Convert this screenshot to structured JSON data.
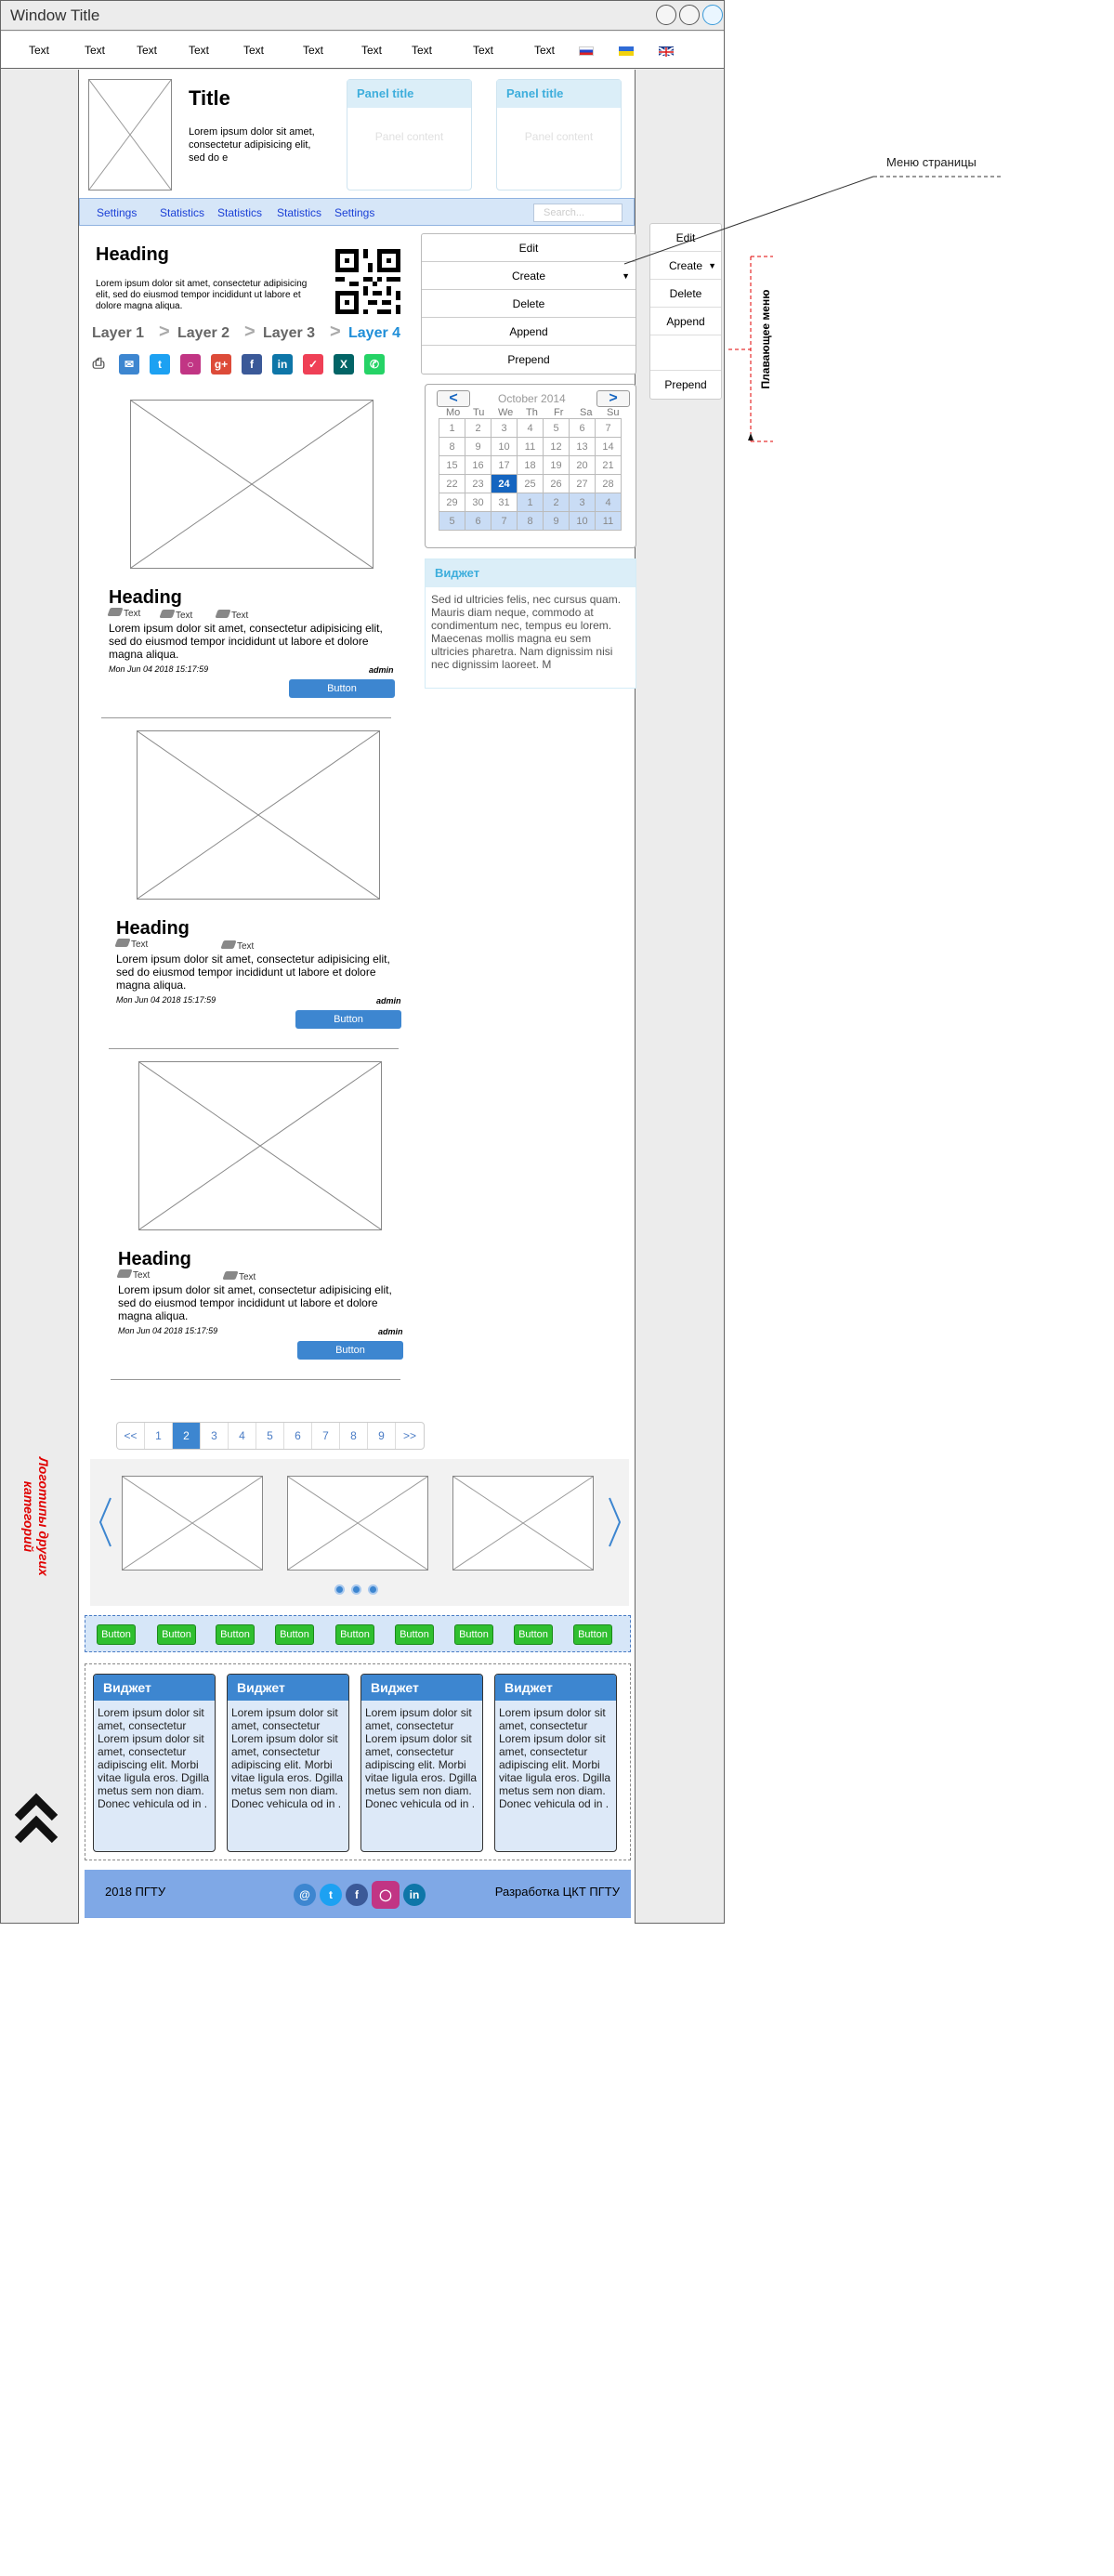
{
  "window": {
    "title": "Window Title"
  },
  "menubar": {
    "items": [
      "Text",
      "Text",
      "Text",
      "Text",
      "Text",
      "Text",
      "Text",
      "Text",
      "Text",
      "Text"
    ]
  },
  "header": {
    "title": "Title",
    "description": "Lorem ipsum dolor sit amet, consectetur adipisicing elit, sed do e"
  },
  "panels": [
    {
      "title": "Panel title",
      "content": "Panel content"
    },
    {
      "title": "Panel title",
      "content": "Panel content"
    }
  ],
  "nav": {
    "items": [
      "Settings",
      "Statistics",
      "Statistics",
      "Statistics",
      "Settings"
    ],
    "search_placeholder": "Search..."
  },
  "intro": {
    "heading": "Heading",
    "text": "Lorem ipsum dolor sit amet, consectetur adipisicing elit, sed do eiusmod tempor incididunt ut labore et dolore magna aliqua."
  },
  "breadcrumb": {
    "items": [
      "Layer 1",
      "Layer 2",
      "Layer 3",
      "Layer 4"
    ],
    "sep": ">"
  },
  "page_menu": {
    "items": [
      "Edit",
      "Create",
      "Delete",
      "Append",
      "Prepend"
    ]
  },
  "floating_menu": {
    "items": [
      "Edit",
      "Create",
      "Delete",
      "Append",
      "",
      "Prepend"
    ],
    "label": "Плавающее меню"
  },
  "annotation": {
    "page_menu_label": "Меню страницы",
    "side_label": "Логотипы других категорий"
  },
  "calendar": {
    "month": "October 2014",
    "prev": "<",
    "next": ">",
    "days": [
      "Mo",
      "Tu",
      "We",
      "Th",
      "Fr",
      "Sa",
      "Su"
    ],
    "weeks": [
      [
        "1",
        "2",
        "3",
        "4",
        "5",
        "6",
        "7"
      ],
      [
        "8",
        "9",
        "10",
        "11",
        "12",
        "13",
        "14"
      ],
      [
        "15",
        "16",
        "17",
        "18",
        "19",
        "20",
        "21"
      ],
      [
        "22",
        "23",
        "24",
        "25",
        "26",
        "27",
        "28"
      ],
      [
        "29",
        "30",
        "31",
        "1",
        "2",
        "3",
        "4"
      ],
      [
        "5",
        "6",
        "7",
        "8",
        "9",
        "10",
        "11"
      ]
    ],
    "selected": "24"
  },
  "widget_side": {
    "title": "Виджет",
    "text": "Sed id ultricies felis, nec cursus quam. Mauris diam neque, commodo at condimentum nec, tempus eu lorem. Maecenas mollis magna eu sem ultricies pharetra. Nam dignissim nisi nec dignissim laoreet. M"
  },
  "articles": [
    {
      "heading": "Heading",
      "tags": [
        "Text",
        "Text",
        "Text"
      ],
      "text": "Lorem ipsum dolor sit amet, consectetur adipisicing elit, sed do eiusmod tempor incididunt ut labore et dolore magna aliqua.",
      "date": "Mon Jun 04 2018 15:17:59",
      "author": "admin",
      "button": "Button"
    },
    {
      "heading": "Heading",
      "tags": [
        "Text",
        "Text"
      ],
      "text": "Lorem ipsum dolor sit amet, consectetur adipisicing elit, sed do eiusmod tempor incididunt ut labore et dolore magna aliqua.",
      "date": "Mon Jun 04 2018 15:17:59",
      "author": "admin",
      "button": "Button"
    },
    {
      "heading": "Heading",
      "tags": [
        "Text",
        "Text"
      ],
      "text": "Lorem ipsum dolor sit amet, consectetur adipisicing elit, sed do eiusmod tempor incididunt ut labore et dolore magna aliqua.",
      "date": "Mon Jun 04 2018 15:17:59",
      "author": "admin",
      "button": "Button"
    }
  ],
  "pagination": {
    "items": [
      "<<",
      "1",
      "2",
      "3",
      "4",
      "5",
      "6",
      "7",
      "8",
      "9",
      ">>"
    ],
    "active": "2"
  },
  "green_buttons": [
    "Button",
    "Button",
    "Button",
    "Button",
    "Button",
    "Button",
    "Button",
    "Button",
    "Button"
  ],
  "widgets": [
    {
      "title": "Виджет",
      "text": "Lorem ipsum dolor sit amet, consectetur Lorem ipsum dolor sit amet, consectetur adipiscing elit. Morbi vitae ligula eros. Dgilla metus sem non diam. Donec vehicula od in ."
    },
    {
      "title": "Виджет",
      "text": "Lorem ipsum dolor sit amet, consectetur Lorem ipsum dolor sit amet, consectetur adipiscing elit. Morbi vitae ligula eros. Dgilla metus sem non diam. Donec vehicula od in ."
    },
    {
      "title": "Виджет",
      "text": "Lorem ipsum dolor sit amet, consectetur Lorem ipsum dolor sit amet, consectetur adipiscing elit. Morbi vitae ligula eros. Dgilla metus sem non diam. Donec vehicula od in ."
    },
    {
      "title": "Виджет",
      "text": "Lorem ipsum dolor sit amet, consectetur Lorem ipsum dolor sit amet, consectetur adipiscing elit. Morbi vitae ligula eros. Dgilla metus sem non diam. Donec vehicula od in ."
    }
  ],
  "footer": {
    "left": "2018 ПГТУ",
    "right": "Разработка ЦКТ ПГТУ"
  },
  "colors": {
    "accent": "#3d86d0",
    "nav_bg": "#d6e6f8",
    "green": "#2fbf2f",
    "footer": "#7fa8e6",
    "red": "#e00000"
  }
}
